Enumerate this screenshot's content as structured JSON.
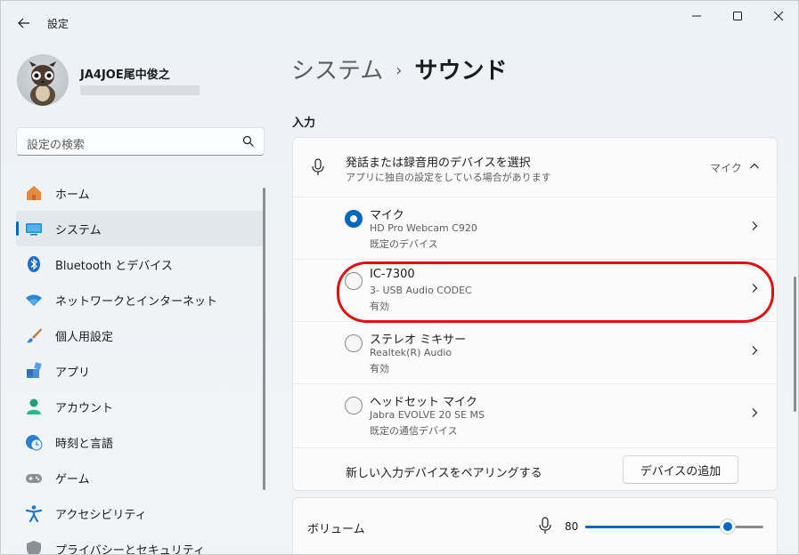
{
  "window": {
    "app_title": "設定",
    "controls": {
      "minimize": "minimize",
      "maximize": "maximize",
      "close": "close"
    }
  },
  "profile": {
    "name": "JA4JOE尾中俊之"
  },
  "search": {
    "placeholder": "設定の検索"
  },
  "nav": {
    "items": [
      {
        "label": "ホーム",
        "icon": "home-icon",
        "selected": false
      },
      {
        "label": "システム",
        "icon": "system-icon",
        "selected": true
      },
      {
        "label": "Bluetooth とデバイス",
        "icon": "bluetooth-icon",
        "selected": false
      },
      {
        "label": "ネットワークとインターネット",
        "icon": "wifi-icon",
        "selected": false
      },
      {
        "label": "個人用設定",
        "icon": "brush-icon",
        "selected": false
      },
      {
        "label": "アプリ",
        "icon": "apps-icon",
        "selected": false
      },
      {
        "label": "アカウント",
        "icon": "account-icon",
        "selected": false
      },
      {
        "label": "時刻と言語",
        "icon": "clock-globe-icon",
        "selected": false
      },
      {
        "label": "ゲーム",
        "icon": "gamepad-icon",
        "selected": false
      },
      {
        "label": "アクセシビリティ",
        "icon": "accessibility-icon",
        "selected": false
      },
      {
        "label": "プライバシーとセキュリティ",
        "icon": "shield-icon",
        "selected": false
      }
    ]
  },
  "breadcrumb": {
    "parent": "システム",
    "separator": "›",
    "current": "サウンド"
  },
  "input_section": {
    "title": "入力",
    "header": {
      "title": "発話または録音用のデバイスを選択",
      "subtitle": "アプリに独自の設定をしている場合があります",
      "value": "マイク"
    },
    "devices": [
      {
        "name": "マイク",
        "model": "HD Pro Webcam C920",
        "status": "既定のデバイス",
        "checked": true
      },
      {
        "name": "IC-7300",
        "model": "3- USB Audio CODEC",
        "status": "有効",
        "checked": false
      },
      {
        "name": "ステレオ ミキサー",
        "model": "Realtek(R) Audio",
        "status": "有効",
        "checked": false
      },
      {
        "name": "ヘッドセット マイク",
        "model": "Jabra EVOLVE 20 SE MS",
        "status": "既定の通信デバイス",
        "checked": false
      }
    ],
    "pair": {
      "label": "新しい入力デバイスをペアリングする",
      "button": "デバイスの追加"
    }
  },
  "volume": {
    "label": "ボリューム",
    "value": "80",
    "level": 0.8
  },
  "colors": {
    "accent": "#0067c0",
    "highlight": "#e01010"
  }
}
